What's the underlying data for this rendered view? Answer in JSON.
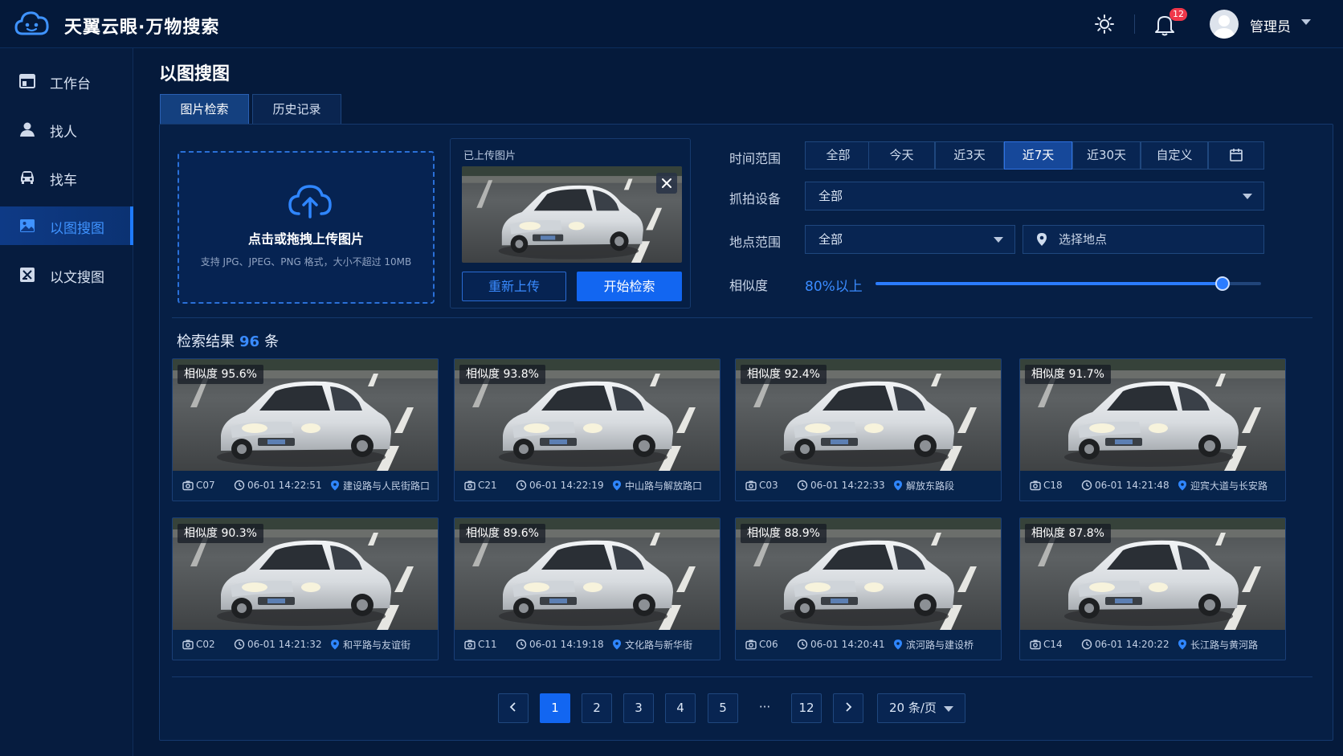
{
  "app": {
    "title": "天翼云眼·万物搜索",
    "notification_count": "12",
    "username": "管理员"
  },
  "sidebar": {
    "items": [
      {
        "label": "工作台",
        "icon": "dashboard-icon"
      },
      {
        "label": "找人",
        "icon": "person-icon"
      },
      {
        "label": "找车",
        "icon": "car-icon"
      },
      {
        "label": "以图搜图",
        "icon": "image-search-icon",
        "active": true
      },
      {
        "label": "以文搜图",
        "icon": "text-search-icon"
      }
    ]
  },
  "page": {
    "title": "以图搜图"
  },
  "tabs": [
    {
      "label": "图片检索",
      "active": true
    },
    {
      "label": "历史记录"
    }
  ],
  "upload": {
    "title": "点击或拖拽上传图片",
    "hint": "支持 JPG、JPEG、PNG 格式，大小不超过 10MB"
  },
  "uploaded": {
    "label": "已上传图片",
    "reupload_label": "重新上传",
    "search_label": "开始检索"
  },
  "filters": {
    "time_label": "时间范围",
    "time_options": [
      "全部",
      "今天",
      "近3天",
      "近7天",
      "近30天",
      "自定义"
    ],
    "time_selected": "近7天",
    "device_label": "抓拍设备",
    "device_value": "全部",
    "location_label": "地点范围",
    "location_value": "全部",
    "location_placeholder": "选择地点",
    "similarity_label": "相似度",
    "similarity_value": "80%以上",
    "similarity_level": 0.9
  },
  "results": {
    "title": "检索结果",
    "count": "96",
    "unit": "条",
    "items": [
      {
        "similarity": "相似度  95.6%",
        "camera": "C07",
        "time": "06-01 14:22:51",
        "location": "建设路与人民街路口"
      },
      {
        "similarity": "相似度  93.8%",
        "camera": "C21",
        "time": "06-01 14:22:19",
        "location": "中山路与解放路口"
      },
      {
        "similarity": "相似度  92.4%",
        "camera": "C03",
        "time": "06-01 14:22:33",
        "location": "解放东路段"
      },
      {
        "similarity": "相似度  91.7%",
        "camera": "C18",
        "time": "06-01 14:21:48",
        "location": "迎宾大道与长安路"
      },
      {
        "similarity": "相似度  90.3%",
        "camera": "C02",
        "time": "06-01 14:21:32",
        "location": "和平路与友谊街"
      },
      {
        "similarity": "相似度  89.6%",
        "camera": "C11",
        "time": "06-01 14:19:18",
        "location": "文化路与新华街"
      },
      {
        "similarity": "相似度  88.9%",
        "camera": "C06",
        "time": "06-01 14:20:41",
        "location": "滨河路与建设桥"
      },
      {
        "similarity": "相似度  87.8%",
        "camera": "C14",
        "time": "06-01 14:20:22",
        "location": "长江路与黄河路"
      }
    ]
  },
  "pagination": {
    "pages": [
      "1",
      "2",
      "3",
      "4",
      "5",
      "···",
      "12"
    ],
    "current": "1",
    "per_page": "20 条/页"
  },
  "colors": {
    "accent": "#1266f1",
    "highlight": "#3a8bff",
    "background": "#051a3b",
    "badge": "#f0374a"
  }
}
